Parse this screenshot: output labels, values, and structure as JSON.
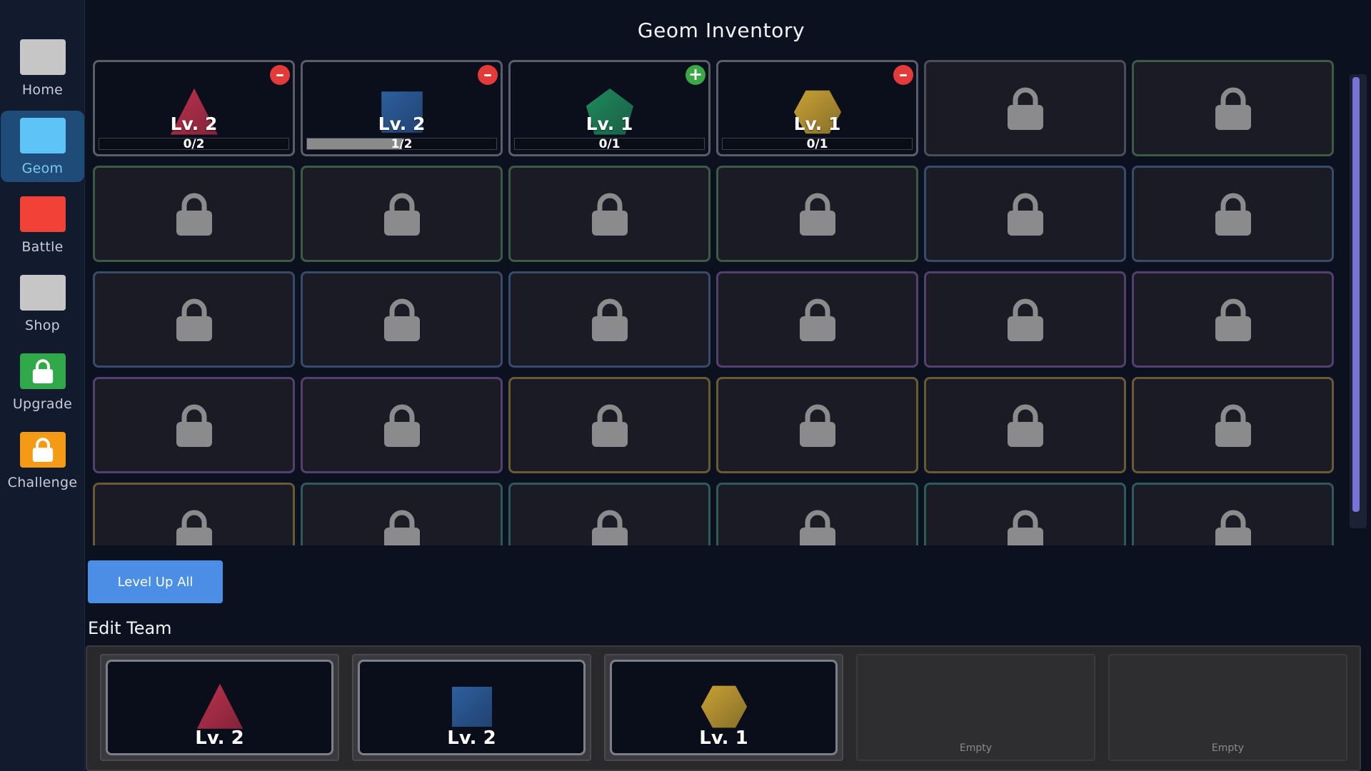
{
  "sidebar": {
    "items": [
      {
        "label": "Home",
        "color": "#c6c6c6",
        "icon": "",
        "active": false
      },
      {
        "label": "Geom",
        "color": "#5ec4f7",
        "icon": "",
        "active": true
      },
      {
        "label": "Battle",
        "color": "#f24136",
        "icon": "",
        "active": false
      },
      {
        "label": "Shop",
        "color": "#c6c6c6",
        "icon": "",
        "active": false
      },
      {
        "label": "Upgrade",
        "color": "#31a84a",
        "icon": "lock-icon",
        "active": false
      },
      {
        "label": "Challenge",
        "color": "#f59a14",
        "icon": "lock-icon",
        "active": false
      }
    ]
  },
  "inventory": {
    "title": "Geom Inventory",
    "slots": [
      {
        "state": "owned",
        "shape": "triangle",
        "color": "#c0304c",
        "level": "Lv. 2",
        "progress_text": "0/2",
        "progress": 0,
        "badge": "remove"
      },
      {
        "state": "owned",
        "shape": "square",
        "color": "#2d5f9e",
        "level": "Lv. 2",
        "progress_text": "1/2",
        "progress": 0.5,
        "badge": "remove"
      },
      {
        "state": "owned",
        "shape": "pentagon",
        "color": "#1f8a5c",
        "level": "Lv. 1",
        "progress_text": "0/1",
        "progress": 0,
        "badge": "add"
      },
      {
        "state": "owned",
        "shape": "hexagon",
        "color": "#c9a233",
        "level": "Lv. 1",
        "progress_text": "0/1",
        "progress": 0,
        "badge": "remove"
      },
      {
        "state": "locked",
        "border": "#4a4e58"
      },
      {
        "state": "locked",
        "border": "#3e5a44"
      },
      {
        "state": "locked",
        "border": "#3e5a44"
      },
      {
        "state": "locked",
        "border": "#3e5a44"
      },
      {
        "state": "locked",
        "border": "#3e5a44"
      },
      {
        "state": "locked",
        "border": "#3e5a44"
      },
      {
        "state": "locked",
        "border": "#3a4a6a"
      },
      {
        "state": "locked",
        "border": "#3a4a6a"
      },
      {
        "state": "locked",
        "border": "#3a4a6a"
      },
      {
        "state": "locked",
        "border": "#3a4a6a"
      },
      {
        "state": "locked",
        "border": "#3a4a6a"
      },
      {
        "state": "locked",
        "border": "#54406e"
      },
      {
        "state": "locked",
        "border": "#54406e"
      },
      {
        "state": "locked",
        "border": "#54406e"
      },
      {
        "state": "locked",
        "border": "#54406e"
      },
      {
        "state": "locked",
        "border": "#54406e"
      },
      {
        "state": "locked",
        "border": "#6a5a34"
      },
      {
        "state": "locked",
        "border": "#6a5a34"
      },
      {
        "state": "locked",
        "border": "#6a5a34"
      },
      {
        "state": "locked",
        "border": "#6a5a34"
      },
      {
        "state": "locked",
        "border": "#6a5a34"
      },
      {
        "state": "locked",
        "border": "#2f5a5c"
      },
      {
        "state": "locked",
        "border": "#2f5a5c"
      },
      {
        "state": "locked",
        "border": "#2f5a5c"
      },
      {
        "state": "locked",
        "border": "#2f5a5c"
      },
      {
        "state": "locked",
        "border": "#2f5a5c"
      }
    ]
  },
  "scroll": {
    "thumb_fraction": 0.97
  },
  "actions": {
    "level_up_all": "Level Up All"
  },
  "team": {
    "title": "Edit Team",
    "slots": [
      {
        "state": "filled",
        "shape": "triangle",
        "color": "#c0304c",
        "level": "Lv. 2"
      },
      {
        "state": "filled",
        "shape": "square",
        "color": "#2d5f9e",
        "level": "Lv. 2"
      },
      {
        "state": "filled",
        "shape": "hexagon",
        "color": "#c9a233",
        "level": "Lv. 1"
      },
      {
        "state": "empty",
        "label": "Empty"
      },
      {
        "state": "empty",
        "label": "Empty"
      }
    ]
  }
}
